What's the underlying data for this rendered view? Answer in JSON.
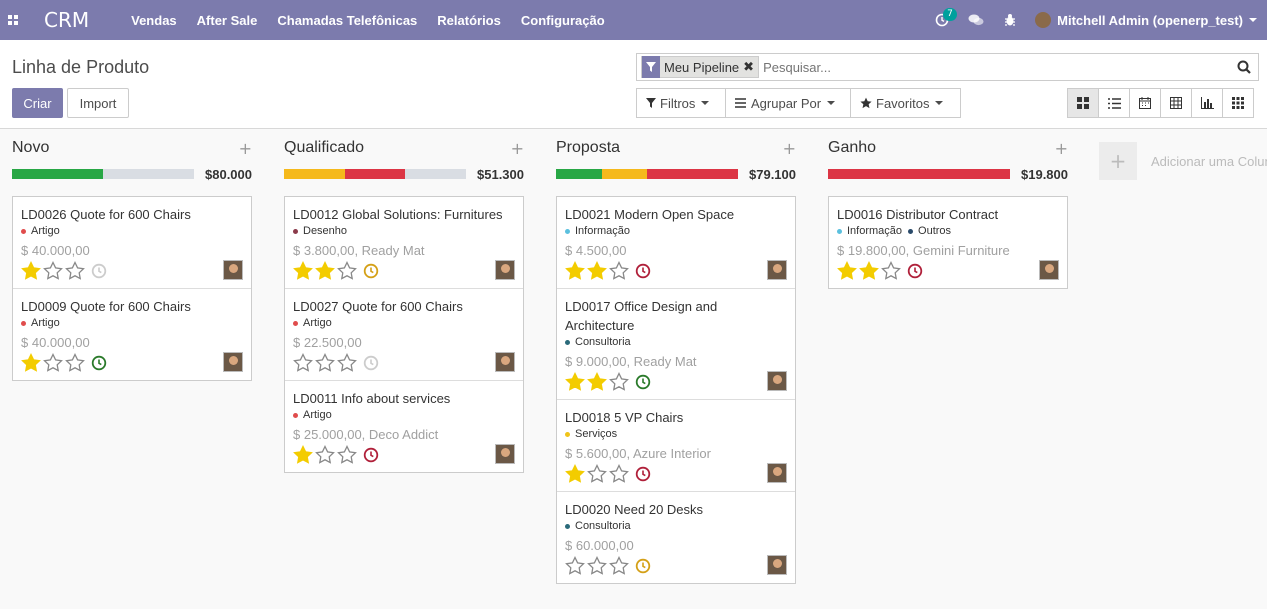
{
  "navbar": {
    "brand": "CRM",
    "menu": [
      "Vendas",
      "After Sale",
      "Chamadas Telefônicas",
      "Relatórios",
      "Configuração"
    ],
    "activity_badge": "7",
    "user": "Mitchell Admin (openerp_test)"
  },
  "control": {
    "title": "Linha de Produto",
    "create_label": "Criar",
    "import_label": "Import",
    "facet_label": "Meu Pipeline",
    "search_placeholder": "Pesquisar...",
    "filters_label": "Filtros",
    "groupby_label": "Agrupar Por",
    "favorites_label": "Favoritos",
    "views": [
      "kanban-icon",
      "list-icon",
      "calendar-icon",
      "pivot-icon",
      "graph-icon",
      "grid-icon"
    ]
  },
  "colors": {
    "green": "#28a745",
    "orange": "#f0ad4e",
    "red": "#dc3545",
    "gray": "#d9dde3",
    "star": "#f3cc00"
  },
  "columns": [
    {
      "title": "Novo",
      "total": "$80.000",
      "progress": [
        {
          "color": "#28a745",
          "pct": 50
        },
        {
          "color": "#d9dde3",
          "pct": 50
        }
      ],
      "cards": [
        {
          "title": "LD0026 Quote for 600 Chairs",
          "tags": [
            {
              "label": "Artigo",
              "color": "#e04c4c"
            }
          ],
          "amount": "$ 40.000,00",
          "stars": 1,
          "clock": "#cccccc"
        },
        {
          "title": "LD0009 Quote for 600 Chairs",
          "tags": [
            {
              "label": "Artigo",
              "color": "#e04c4c"
            }
          ],
          "amount": "$ 40.000,00",
          "stars": 1,
          "clock": "#2a7a2a"
        }
      ]
    },
    {
      "title": "Qualificado",
      "total": "$51.300",
      "progress": [
        {
          "color": "#f5b91c",
          "pct": 33.3
        },
        {
          "color": "#dc3545",
          "pct": 33.3
        },
        {
          "color": "#d9dde3",
          "pct": 33.4
        }
      ],
      "cards": [
        {
          "title": "LD0012 Global Solutions: Furnitures",
          "tags": [
            {
              "label": "Desenho",
              "color": "#8b3a4a"
            }
          ],
          "amount": "$ 3.800,00, Ready Mat",
          "stars": 2,
          "clock": "#d4a017"
        },
        {
          "title": "LD0027 Quote for 600 Chairs",
          "tags": [
            {
              "label": "Artigo",
              "color": "#e04c4c"
            }
          ],
          "amount": "$ 22.500,00",
          "stars": 0,
          "clock": "#cccccc"
        },
        {
          "title": "LD0011 Info about services",
          "tags": [
            {
              "label": "Artigo",
              "color": "#e04c4c"
            }
          ],
          "amount": "$ 25.000,00, Deco Addict",
          "stars": 1,
          "clock": "#b0203a"
        }
      ]
    },
    {
      "title": "Proposta",
      "total": "$79.100",
      "progress": [
        {
          "color": "#28a745",
          "pct": 25
        },
        {
          "color": "#f5b91c",
          "pct": 25
        },
        {
          "color": "#dc3545",
          "pct": 50
        }
      ],
      "cards": [
        {
          "title": "LD0021 Modern Open Space",
          "tags": [
            {
              "label": "Informação",
              "color": "#5bc0de"
            }
          ],
          "amount": "$ 4.500,00",
          "stars": 2,
          "clock": "#b0203a"
        },
        {
          "title": "LD0017 Office Design and Architecture",
          "tags": [
            {
              "label": "Consultoria",
              "color": "#2a6a7a"
            }
          ],
          "amount": "$ 9.000,00, Ready Mat",
          "stars": 2,
          "clock": "#2a7a2a"
        },
        {
          "title": "LD0018 5 VP Chairs",
          "tags": [
            {
              "label": "Serviços",
              "color": "#f0c419"
            }
          ],
          "amount": "$ 5.600,00, Azure Interior",
          "stars": 1,
          "clock": "#b0203a"
        },
        {
          "title": "LD0020 Need 20 Desks",
          "tags": [
            {
              "label": "Consultoria",
              "color": "#2a6a7a"
            }
          ],
          "amount": "$ 60.000,00",
          "stars": 0,
          "clock": "#d4a017"
        }
      ]
    },
    {
      "title": "Ganho",
      "total": "$19.800",
      "progress": [
        {
          "color": "#dc3545",
          "pct": 100
        }
      ],
      "cards": [
        {
          "title": "LD0016 Distributor Contract",
          "tags": [
            {
              "label": "Informação",
              "color": "#5bc0de"
            },
            {
              "label": "Outros",
              "color": "#2a4a6a"
            }
          ],
          "amount": "$ 19.800,00, Gemini Furniture",
          "stars": 2,
          "clock": "#b0203a"
        }
      ]
    }
  ],
  "add_column_label": "Adicionar uma Coluna"
}
